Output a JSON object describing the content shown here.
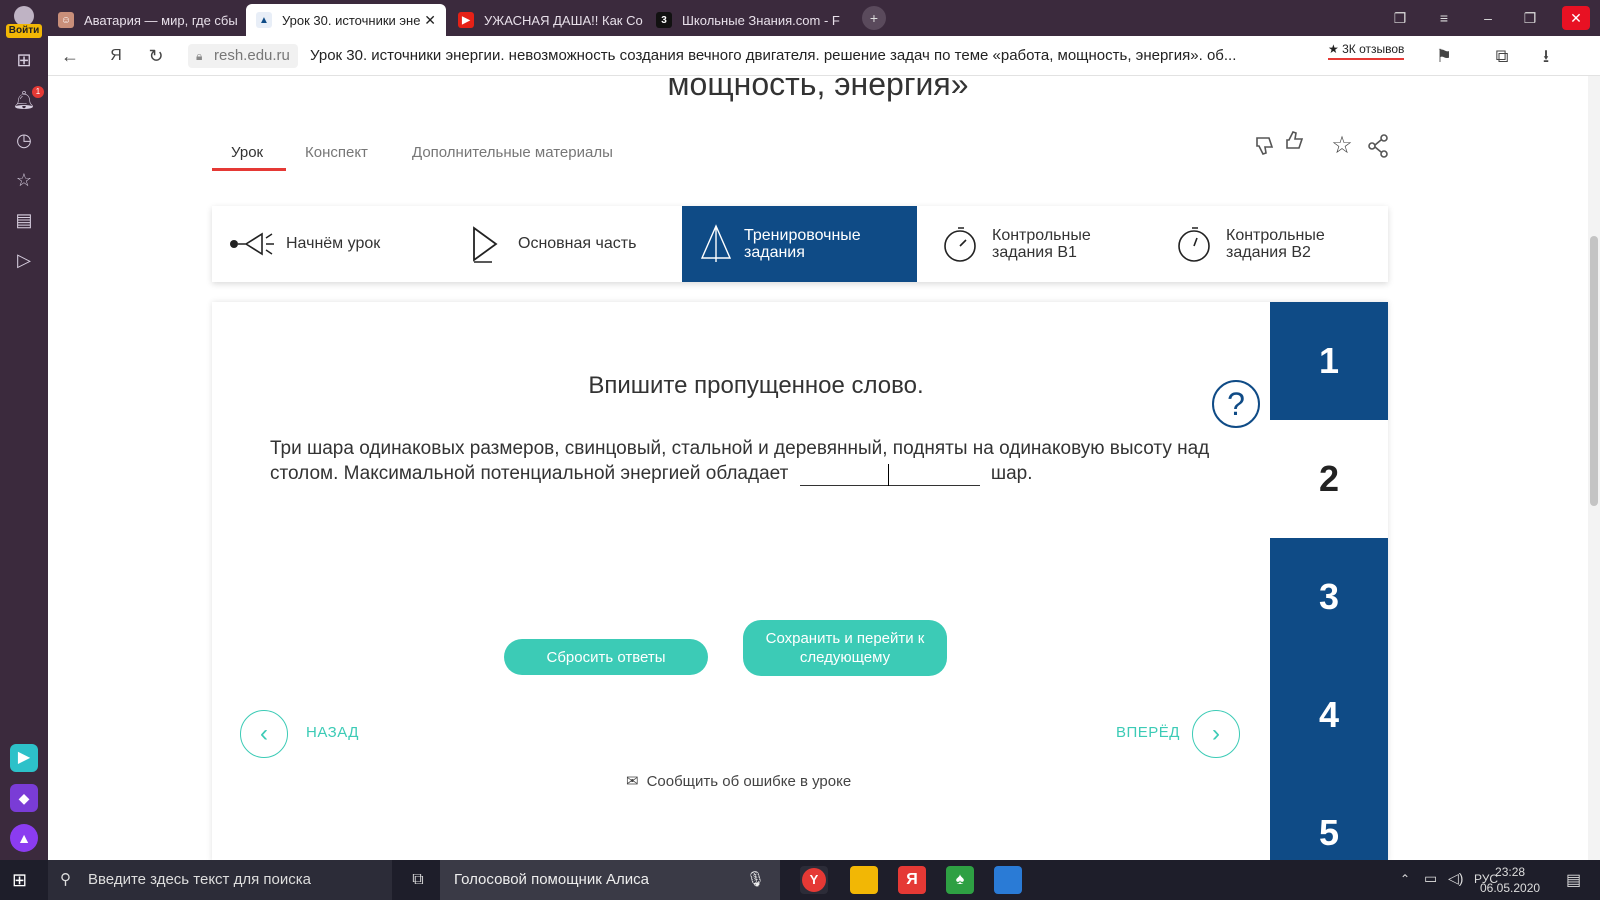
{
  "browser": {
    "tabs": [
      {
        "title": "Аватария — мир, где сбы"
      },
      {
        "title": "Урок 30. источники эне"
      },
      {
        "title": "УЖАСНАЯ ДАША!! Как Со"
      },
      {
        "title": "Школьные Знания.com - F"
      }
    ],
    "login_label": "Войти",
    "notification_count": "1",
    "yandex_letter": "Я",
    "url": "resh.edu.ru",
    "page_title": "Урок 30. источники энергии. невозможность создания вечного двигателя. решение задач по теме «работа, мощность, энергия». об...",
    "reviews": "3К отзывов"
  },
  "lesson": {
    "heading": "мощность, энергия»",
    "tabs": [
      "Урок",
      "Конспект",
      "Дополнительные материалы"
    ],
    "stages": [
      {
        "label": "Начнём урок"
      },
      {
        "label": "Основная часть"
      },
      {
        "label": "Тренировочные задания"
      },
      {
        "label": "Контрольные задания В1"
      },
      {
        "label": "Контрольные задания В2"
      }
    ]
  },
  "task": {
    "title": "Впишите пропущенное слово.",
    "help": "?",
    "text_before": "Три шара одинаковых размеров, свинцовый, стальной и деревянный, подняты на одинаковую высоту над столом. Максимальной потенциальной энергией обладает",
    "text_after": "шар.",
    "reset_label": "Сбросить ответы",
    "save_label": "Сохранить и перейти к следующему",
    "back_label": "НАЗАД",
    "forward_label": "ВПЕРЁД",
    "report_label": "Сообщить об ошибке в уроке",
    "question_numbers": [
      "1",
      "2",
      "3",
      "4",
      "5"
    ]
  },
  "taskbar": {
    "search_placeholder": "Введите здесь текст для поиска",
    "alice_label": "Голосовой помощник Алиса",
    "language": "РУС",
    "time": "23:28",
    "date": "06.05.2020"
  },
  "colors": {
    "brand_blue": "#0f4b86",
    "accent_teal": "#3ccbb6",
    "accent_red": "#e53935",
    "chrome_purple": "#3b2a3d"
  }
}
